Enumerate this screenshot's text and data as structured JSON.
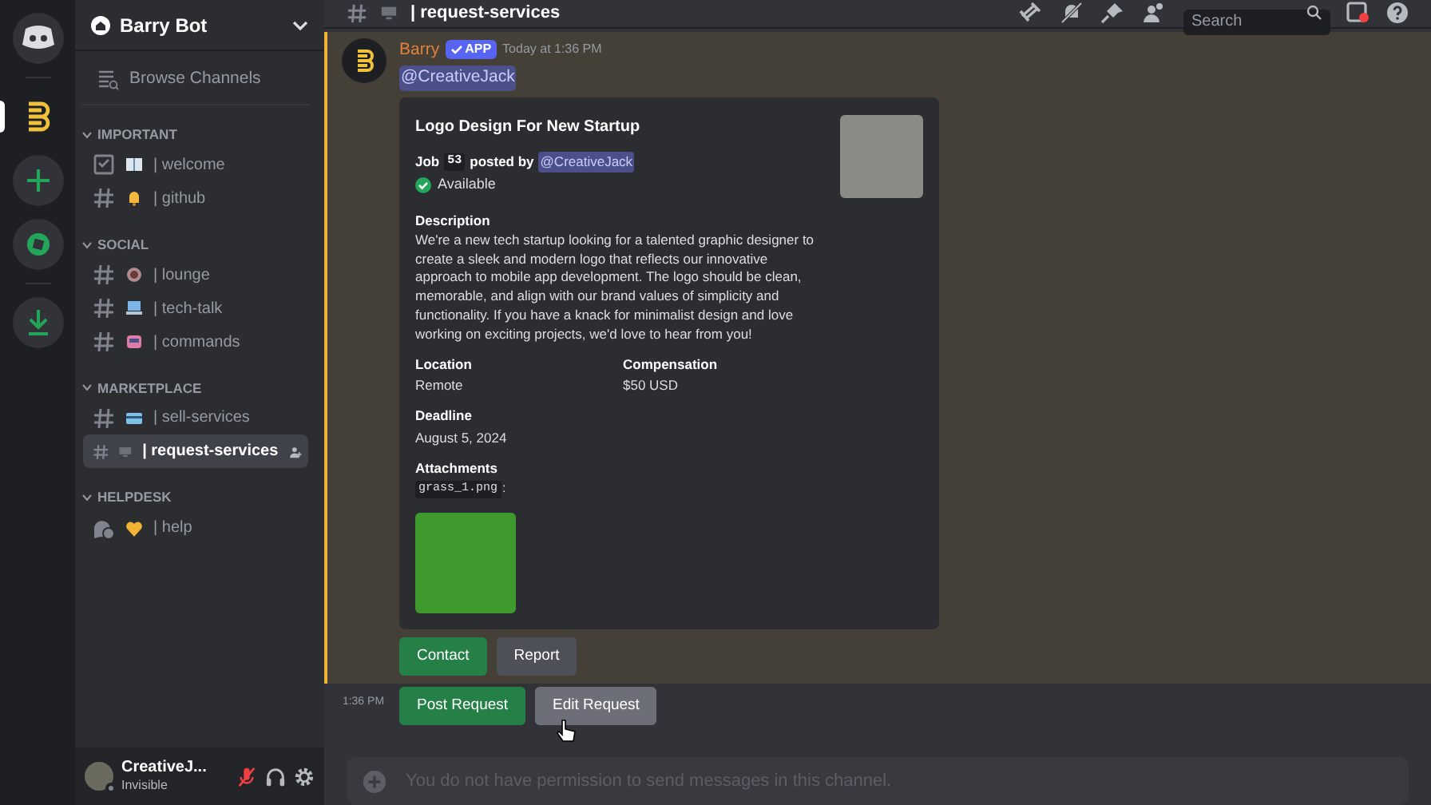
{
  "server": {
    "name": "Barry Bot"
  },
  "rail": [
    {
      "kind": "home",
      "selected": false
    },
    {
      "kind": "server",
      "selected": true
    },
    {
      "kind": "add",
      "selected": false
    },
    {
      "kind": "discover",
      "selected": false
    },
    {
      "kind": "download",
      "selected": false
    }
  ],
  "sidebar": {
    "browse": "Browse Channels",
    "categories": [
      {
        "name": "IMPORTANT",
        "expanded": true,
        "channels": [
          {
            "kind": "rules",
            "emoji": {
              "kind": "book"
            },
            "name": "| welcome",
            "selected": false
          },
          {
            "kind": "text",
            "emoji": {
              "kind": "bell"
            },
            "name": "| github",
            "selected": false
          }
        ]
      },
      {
        "name": "SOCIAL",
        "expanded": true,
        "channels": [
          {
            "kind": "text",
            "emoji": {
              "kind": "cup"
            },
            "name": "| lounge",
            "selected": false
          },
          {
            "kind": "text",
            "emoji": {
              "kind": "laptop"
            },
            "name": "| tech-talk",
            "selected": false
          },
          {
            "kind": "text",
            "emoji": {
              "kind": "robot"
            },
            "name": "| commands",
            "selected": false
          }
        ]
      },
      {
        "name": "MARKETPLACE",
        "expanded": true,
        "channels": [
          {
            "kind": "text",
            "emoji": {
              "kind": "card"
            },
            "name": "| sell-services",
            "selected": false
          },
          {
            "kind": "text",
            "emoji": {
              "kind": "monitor"
            },
            "name": "| request-services",
            "selected": true
          }
        ]
      },
      {
        "name": "HELPDESK",
        "expanded": true,
        "channels": [
          {
            "kind": "forum",
            "emoji": {
              "kind": "heart"
            },
            "name": "| help",
            "selected": false
          }
        ]
      }
    ]
  },
  "user": {
    "name": "CreativeJ...",
    "status": "Invisible",
    "muted": true
  },
  "header": {
    "channel": "| request-services",
    "search_placeholder": "Search"
  },
  "messages": [
    {
      "author": "Barry",
      "badge": "APP",
      "time": "Today at 1:36 PM",
      "mention": "@CreativeJack",
      "highlighted": true,
      "embed": {
        "title": "Logo Design For New Startup",
        "job_label": "Job",
        "job_number": "53",
        "posted_by": "posted by",
        "poster": "@CreativeJack",
        "status": "Available",
        "description_label": "Description",
        "description": "We're a new tech startup looking for a talented graphic designer to create a sleek and modern logo that reflects our innovative approach to mobile app development. The logo should be clean, memorable, and align with our brand values of simplicity and functionality. If you have a knack for minimalist design and love working on exciting projects, we'd love to hear from you!",
        "fields": [
          {
            "name": "Location",
            "value": "Remote"
          },
          {
            "name": "Compensation",
            "value": "$50 USD"
          },
          {
            "name": "Deadline",
            "value": "August 5, 2024"
          }
        ],
        "attachments_label": "Attachments",
        "attachment_file": "grass_1.png",
        "attachment_suffix": ":"
      },
      "buttons": [
        {
          "label": "Contact",
          "kind": "success",
          "hovered": false
        },
        {
          "label": "Report",
          "kind": "secondary",
          "hovered": false
        }
      ]
    },
    {
      "time": "1:36 PM",
      "highlighted": false,
      "buttons": [
        {
          "label": "Post Request",
          "kind": "success",
          "hovered": false
        },
        {
          "label": "Edit Request",
          "kind": "secondary",
          "hovered": true
        }
      ]
    }
  ],
  "composer": {
    "placeholder": "You do not have permission to send messages in this channel."
  }
}
